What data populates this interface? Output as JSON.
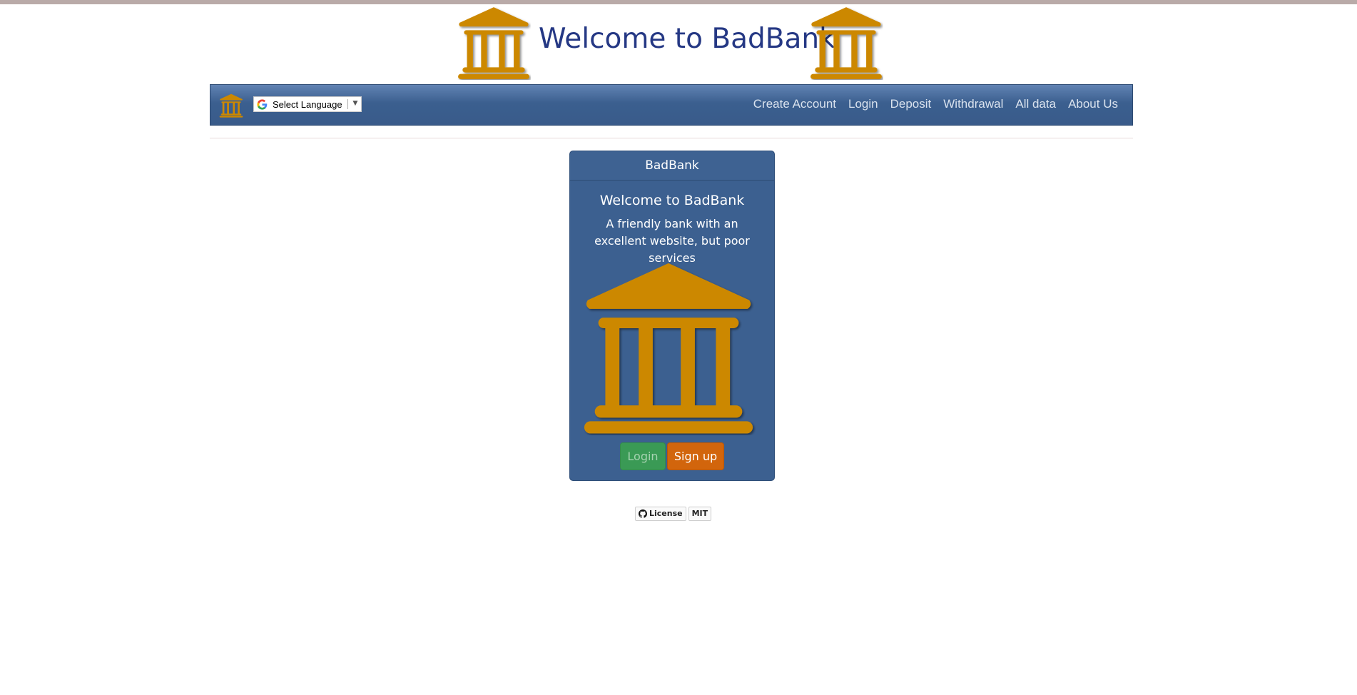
{
  "header": {
    "title": "Welcome to BadBank",
    "icon": "bank-icon"
  },
  "navbar": {
    "brand_icon": "bank-icon",
    "language_select": {
      "label": "Select Language",
      "arrow": "▼",
      "icon": "google-icon"
    },
    "links": [
      "Create Account",
      "Login",
      "Deposit",
      "Withdrawal",
      "All data",
      "About Us"
    ]
  },
  "card": {
    "header": "BadBank",
    "title": "Welcome to BadBank",
    "text": "A friendly bank with an excellent website, but poor services",
    "image": "bank-icon",
    "login_label": "Login",
    "signup_label": "Sign up"
  },
  "footer_badge": {
    "left": "License",
    "right": "MIT",
    "icon": "github-icon"
  },
  "colors": {
    "accent_gold": "#cc8800",
    "nav_blue": "#3b5f8f",
    "title_blue": "#253884",
    "login_green": "#3a9a55",
    "signup_orange": "#d2650c"
  }
}
